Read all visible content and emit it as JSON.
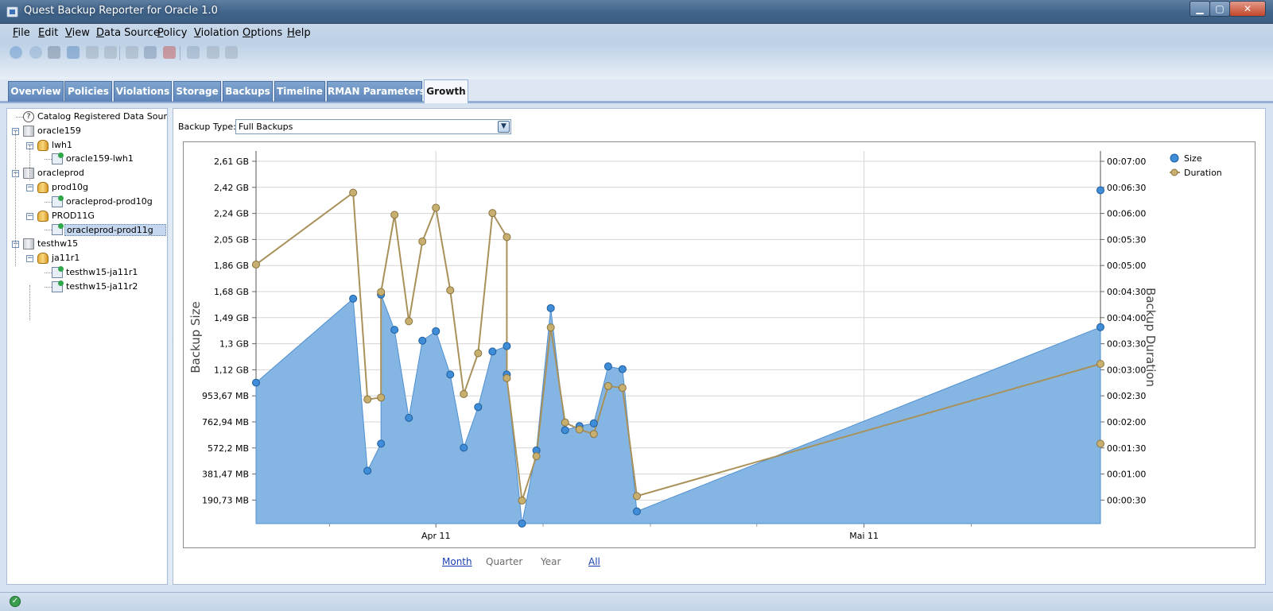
{
  "window": {
    "title": "Quest Backup Reporter for Oracle 1.0"
  },
  "menu": [
    "File",
    "Edit",
    "View",
    "Data Source",
    "Policy",
    "Violation",
    "Options",
    "Help"
  ],
  "toolbar_icons": [
    "back-icon",
    "forward-icon",
    "home-icon",
    "refresh-icon",
    "print-icon",
    "export-icon",
    "add-source-icon",
    "edit-source-icon",
    "delete-source-icon",
    "move-icon",
    "up-icon",
    "down-icon"
  ],
  "tabs": [
    "Overview",
    "Policies",
    "Violations",
    "Storage",
    "Backups",
    "Timeline",
    "RMAN Parameters",
    "Growth"
  ],
  "active_tab": "Growth",
  "tree": [
    {
      "label": "Catalog Registered Data Sourc...",
      "kind": "info",
      "level": 0
    },
    {
      "label": "oracle159",
      "kind": "server",
      "level": 0
    },
    {
      "label": "lwh1",
      "kind": "db",
      "level": 1
    },
    {
      "label": "oracle159-lwh1",
      "kind": "instance",
      "level": 2
    },
    {
      "label": "oracleprod",
      "kind": "server",
      "level": 0
    },
    {
      "label": "prod10g",
      "kind": "db",
      "level": 1
    },
    {
      "label": "oracleprod-prod10g",
      "kind": "instance",
      "level": 2
    },
    {
      "label": "PROD11G",
      "kind": "db",
      "level": 1
    },
    {
      "label": "oracleprod-prod11g",
      "kind": "instance",
      "level": 2,
      "selected": true
    },
    {
      "label": "testhw15",
      "kind": "server",
      "level": 0
    },
    {
      "label": "ja11r1",
      "kind": "db",
      "level": 1
    },
    {
      "label": "testhw15-ja11r1",
      "kind": "instance",
      "level": 2
    },
    {
      "label": "testhw15-ja11r2",
      "kind": "instance",
      "level": 2
    }
  ],
  "filter": {
    "label": "Backup Type:",
    "value": "Full Backups"
  },
  "period_links": [
    {
      "label": "Month",
      "link": true
    },
    {
      "label": "Quarter",
      "link": false
    },
    {
      "label": "Year",
      "link": false
    },
    {
      "label": "All",
      "link": true
    }
  ],
  "chart_data": {
    "type": "area",
    "ylabel": "Backup Size",
    "y2label": "Backup Duration",
    "y_ticks": [
      "2,61 GB",
      "2,42 GB",
      "2,24 GB",
      "2,05 GB",
      "1,86 GB",
      "1,68 GB",
      "1,49 GB",
      "1,3 GB",
      "1,12 GB",
      "953,67 MB",
      "762,94 MB",
      "572,2 MB",
      "381,47 MB",
      "190,73 MB"
    ],
    "y2_ticks": [
      "00:07:00",
      "00:06:30",
      "00:06:00",
      "00:05:30",
      "00:05:00",
      "00:04:30",
      "00:04:00",
      "00:03:30",
      "00:03:00",
      "00:02:30",
      "00:02:00",
      "00:01:30",
      "00:01:00",
      "00:00:30"
    ],
    "x_ticks": [
      {
        "label": "Apr 11",
        "pos": 0.213
      },
      {
        "label": "Mai 11",
        "pos": 0.72
      }
    ],
    "legend_position": "top-right",
    "colors": {
      "size_fill": "#85b6e3",
      "size_line": "#4f8fd0",
      "size_marker": "#3f8cd8",
      "duration_line": "#a8915a",
      "duration_marker": "#c7b06f"
    },
    "ylim_gb": [
      0,
      2.75
    ],
    "y2lim_sec": [
      0,
      420
    ],
    "series": [
      {
        "name": "Size",
        "unit": "GB",
        "points": [
          [
            0.0,
            1.04
          ],
          [
            0.115,
            1.66
          ],
          [
            0.132,
            0.39
          ],
          [
            0.148,
            0.59
          ],
          [
            0.148,
            1.69
          ],
          [
            0.164,
            1.43
          ],
          [
            0.181,
            0.78
          ],
          [
            0.197,
            1.35
          ],
          [
            0.213,
            1.42
          ],
          [
            0.23,
            1.1
          ],
          [
            0.246,
            0.56
          ],
          [
            0.263,
            0.86
          ],
          [
            0.28,
            1.27
          ],
          [
            0.297,
            1.31
          ],
          [
            0.297,
            1.1
          ],
          [
            0.315,
            0.0
          ],
          [
            0.332,
            0.54
          ],
          [
            0.349,
            1.59
          ],
          [
            0.366,
            0.69
          ],
          [
            0.383,
            0.72
          ],
          [
            0.4,
            0.74
          ],
          [
            0.417,
            1.16
          ],
          [
            0.434,
            1.14
          ],
          [
            0.451,
            0.09
          ],
          [
            1.0,
            1.45
          ]
        ]
      },
      {
        "name": "Duration",
        "unit": "sec",
        "points": [
          [
            0.0,
            292
          ],
          [
            0.115,
            373
          ],
          [
            0.132,
            140
          ],
          [
            0.148,
            142
          ],
          [
            0.148,
            261
          ],
          [
            0.164,
            348
          ],
          [
            0.181,
            228
          ],
          [
            0.197,
            318
          ],
          [
            0.213,
            356
          ],
          [
            0.23,
            263
          ],
          [
            0.246,
            146
          ],
          [
            0.263,
            192
          ],
          [
            0.28,
            350
          ],
          [
            0.297,
            323
          ],
          [
            0.297,
            164
          ],
          [
            0.315,
            26
          ],
          [
            0.332,
            76
          ],
          [
            0.349,
            221
          ],
          [
            0.366,
            114
          ],
          [
            0.383,
            106
          ],
          [
            0.4,
            101
          ],
          [
            0.417,
            155
          ],
          [
            0.434,
            153
          ],
          [
            0.451,
            31
          ],
          [
            1.0,
            180
          ]
        ]
      }
    ],
    "extra_points": {
      "size_right": [
        [
          1.0,
          2.46
        ]
      ],
      "duration_right": [
        [
          1.0,
          90
        ]
      ]
    }
  }
}
